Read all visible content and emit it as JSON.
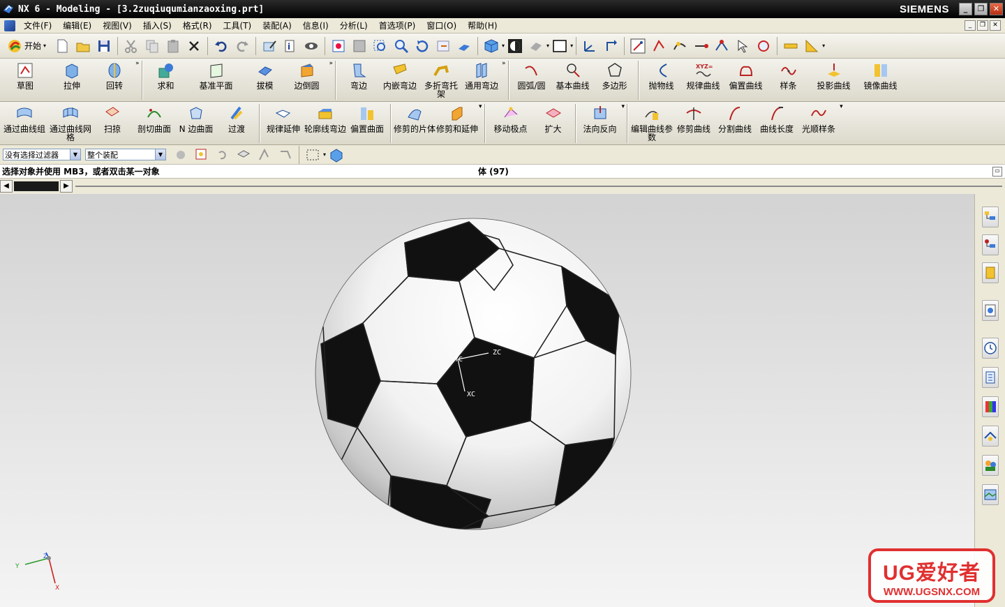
{
  "titlebar": {
    "title": "NX 6 - Modeling - [3.2zuqiuqumianzaoxing.prt]",
    "brand": "SIEMENS"
  },
  "menubar": {
    "items": [
      "文件(F)",
      "编辑(E)",
      "视图(V)",
      "插入(S)",
      "格式(R)",
      "工具(T)",
      "装配(A)",
      "信息(I)",
      "分析(L)",
      "首选项(P)",
      "窗口(O)",
      "帮助(H)"
    ]
  },
  "toolbar": {
    "start_label": "开始"
  },
  "ribbon1": {
    "items": [
      "草图",
      "拉伸",
      "回转",
      "求和",
      "基准平面",
      "拔模",
      "边倒圆",
      "弯边",
      "内嵌弯边",
      "多折弯托架",
      "通用弯边",
      "圆弧/圆",
      "基本曲线",
      "多边形",
      "抛物线",
      "规律曲线",
      "偏置曲线",
      "样条",
      "投影曲线",
      "镜像曲线"
    ]
  },
  "ribbon2": {
    "items": [
      "通过曲线组",
      "通过曲线网格",
      "扫掠",
      "剖切曲面",
      "N 边曲面",
      "过渡",
      "规律延伸",
      "轮廓线弯边",
      "偏置曲面",
      "修剪的片体",
      "修剪和延伸",
      "移动极点",
      "扩大",
      "法向反向",
      "编辑曲线参数",
      "修剪曲线",
      "分割曲线",
      "曲线长度",
      "光顺样条"
    ]
  },
  "selection": {
    "filter": "没有选择过滤器",
    "scope": "整个装配"
  },
  "status": {
    "prompt": "选择对象并使用 MB3，或者双击某一对象",
    "info": "体 (97)"
  },
  "viewport": {
    "axis_zc": "ZC",
    "axis_yc": "YC",
    "axis_xc": "XC",
    "triad_z": "Z",
    "triad_y": "Y",
    "triad_x": "X"
  },
  "watermark": {
    "line1": "UG爱好者",
    "line2": "WWW.UGSNX.COM"
  },
  "colors": {
    "accent": "#e03030",
    "title_bg": "#000000",
    "menu_bg": "#ece9d8"
  }
}
